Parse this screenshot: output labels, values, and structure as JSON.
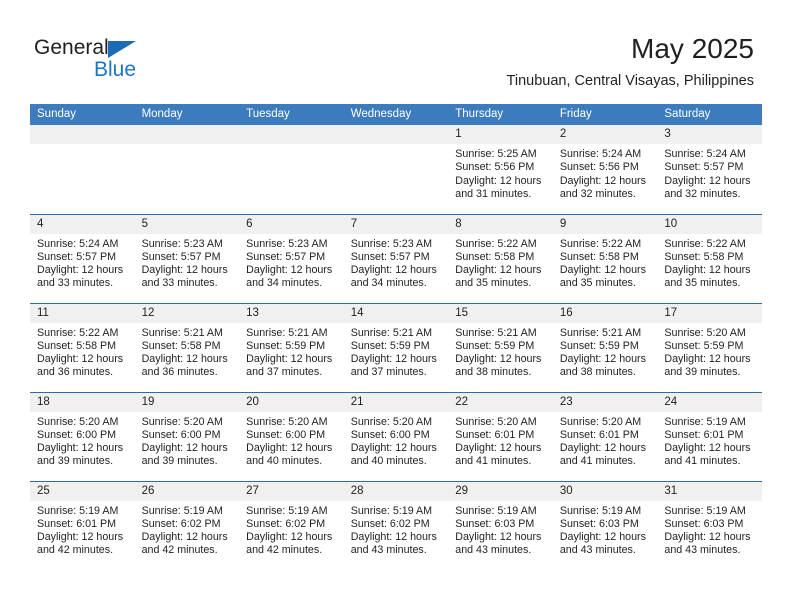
{
  "brand": {
    "line1": "General",
    "line2": "Blue",
    "triangle_color": "#1c6cb5"
  },
  "header": {
    "month_title": "May 2025",
    "location": "Tinubuan, Central Visayas, Philippines"
  },
  "theme": {
    "header_bg": "#3c7cbe",
    "header_text": "#ffffff",
    "daynum_band_bg": "#f0f0f0",
    "row_divider": "#2e6da4",
    "text": "#231f20"
  },
  "calendar": {
    "weekday_headers": [
      "Sunday",
      "Monday",
      "Tuesday",
      "Wednesday",
      "Thursday",
      "Friday",
      "Saturday"
    ],
    "weeks": [
      [
        {
          "day": "",
          "empty": true
        },
        {
          "day": "",
          "empty": true
        },
        {
          "day": "",
          "empty": true
        },
        {
          "day": "",
          "empty": true
        },
        {
          "day": "1",
          "sunrise": "Sunrise: 5:25 AM",
          "sunset": "Sunset: 5:56 PM",
          "daylight1": "Daylight: 12 hours",
          "daylight2": "and 31 minutes."
        },
        {
          "day": "2",
          "sunrise": "Sunrise: 5:24 AM",
          "sunset": "Sunset: 5:56 PM",
          "daylight1": "Daylight: 12 hours",
          "daylight2": "and 32 minutes."
        },
        {
          "day": "3",
          "sunrise": "Sunrise: 5:24 AM",
          "sunset": "Sunset: 5:57 PM",
          "daylight1": "Daylight: 12 hours",
          "daylight2": "and 32 minutes."
        }
      ],
      [
        {
          "day": "4",
          "sunrise": "Sunrise: 5:24 AM",
          "sunset": "Sunset: 5:57 PM",
          "daylight1": "Daylight: 12 hours",
          "daylight2": "and 33 minutes."
        },
        {
          "day": "5",
          "sunrise": "Sunrise: 5:23 AM",
          "sunset": "Sunset: 5:57 PM",
          "daylight1": "Daylight: 12 hours",
          "daylight2": "and 33 minutes."
        },
        {
          "day": "6",
          "sunrise": "Sunrise: 5:23 AM",
          "sunset": "Sunset: 5:57 PM",
          "daylight1": "Daylight: 12 hours",
          "daylight2": "and 34 minutes."
        },
        {
          "day": "7",
          "sunrise": "Sunrise: 5:23 AM",
          "sunset": "Sunset: 5:57 PM",
          "daylight1": "Daylight: 12 hours",
          "daylight2": "and 34 minutes."
        },
        {
          "day": "8",
          "sunrise": "Sunrise: 5:22 AM",
          "sunset": "Sunset: 5:58 PM",
          "daylight1": "Daylight: 12 hours",
          "daylight2": "and 35 minutes."
        },
        {
          "day": "9",
          "sunrise": "Sunrise: 5:22 AM",
          "sunset": "Sunset: 5:58 PM",
          "daylight1": "Daylight: 12 hours",
          "daylight2": "and 35 minutes."
        },
        {
          "day": "10",
          "sunrise": "Sunrise: 5:22 AM",
          "sunset": "Sunset: 5:58 PM",
          "daylight1": "Daylight: 12 hours",
          "daylight2": "and 35 minutes."
        }
      ],
      [
        {
          "day": "11",
          "sunrise": "Sunrise: 5:22 AM",
          "sunset": "Sunset: 5:58 PM",
          "daylight1": "Daylight: 12 hours",
          "daylight2": "and 36 minutes."
        },
        {
          "day": "12",
          "sunrise": "Sunrise: 5:21 AM",
          "sunset": "Sunset: 5:58 PM",
          "daylight1": "Daylight: 12 hours",
          "daylight2": "and 36 minutes."
        },
        {
          "day": "13",
          "sunrise": "Sunrise: 5:21 AM",
          "sunset": "Sunset: 5:59 PM",
          "daylight1": "Daylight: 12 hours",
          "daylight2": "and 37 minutes."
        },
        {
          "day": "14",
          "sunrise": "Sunrise: 5:21 AM",
          "sunset": "Sunset: 5:59 PM",
          "daylight1": "Daylight: 12 hours",
          "daylight2": "and 37 minutes."
        },
        {
          "day": "15",
          "sunrise": "Sunrise: 5:21 AM",
          "sunset": "Sunset: 5:59 PM",
          "daylight1": "Daylight: 12 hours",
          "daylight2": "and 38 minutes."
        },
        {
          "day": "16",
          "sunrise": "Sunrise: 5:21 AM",
          "sunset": "Sunset: 5:59 PM",
          "daylight1": "Daylight: 12 hours",
          "daylight2": "and 38 minutes."
        },
        {
          "day": "17",
          "sunrise": "Sunrise: 5:20 AM",
          "sunset": "Sunset: 5:59 PM",
          "daylight1": "Daylight: 12 hours",
          "daylight2": "and 39 minutes."
        }
      ],
      [
        {
          "day": "18",
          "sunrise": "Sunrise: 5:20 AM",
          "sunset": "Sunset: 6:00 PM",
          "daylight1": "Daylight: 12 hours",
          "daylight2": "and 39 minutes."
        },
        {
          "day": "19",
          "sunrise": "Sunrise: 5:20 AM",
          "sunset": "Sunset: 6:00 PM",
          "daylight1": "Daylight: 12 hours",
          "daylight2": "and 39 minutes."
        },
        {
          "day": "20",
          "sunrise": "Sunrise: 5:20 AM",
          "sunset": "Sunset: 6:00 PM",
          "daylight1": "Daylight: 12 hours",
          "daylight2": "and 40 minutes."
        },
        {
          "day": "21",
          "sunrise": "Sunrise: 5:20 AM",
          "sunset": "Sunset: 6:00 PM",
          "daylight1": "Daylight: 12 hours",
          "daylight2": "and 40 minutes."
        },
        {
          "day": "22",
          "sunrise": "Sunrise: 5:20 AM",
          "sunset": "Sunset: 6:01 PM",
          "daylight1": "Daylight: 12 hours",
          "daylight2": "and 41 minutes."
        },
        {
          "day": "23",
          "sunrise": "Sunrise: 5:20 AM",
          "sunset": "Sunset: 6:01 PM",
          "daylight1": "Daylight: 12 hours",
          "daylight2": "and 41 minutes."
        },
        {
          "day": "24",
          "sunrise": "Sunrise: 5:19 AM",
          "sunset": "Sunset: 6:01 PM",
          "daylight1": "Daylight: 12 hours",
          "daylight2": "and 41 minutes."
        }
      ],
      [
        {
          "day": "25",
          "sunrise": "Sunrise: 5:19 AM",
          "sunset": "Sunset: 6:01 PM",
          "daylight1": "Daylight: 12 hours",
          "daylight2": "and 42 minutes."
        },
        {
          "day": "26",
          "sunrise": "Sunrise: 5:19 AM",
          "sunset": "Sunset: 6:02 PM",
          "daylight1": "Daylight: 12 hours",
          "daylight2": "and 42 minutes."
        },
        {
          "day": "27",
          "sunrise": "Sunrise: 5:19 AM",
          "sunset": "Sunset: 6:02 PM",
          "daylight1": "Daylight: 12 hours",
          "daylight2": "and 42 minutes."
        },
        {
          "day": "28",
          "sunrise": "Sunrise: 5:19 AM",
          "sunset": "Sunset: 6:02 PM",
          "daylight1": "Daylight: 12 hours",
          "daylight2": "and 43 minutes."
        },
        {
          "day": "29",
          "sunrise": "Sunrise: 5:19 AM",
          "sunset": "Sunset: 6:03 PM",
          "daylight1": "Daylight: 12 hours",
          "daylight2": "and 43 minutes."
        },
        {
          "day": "30",
          "sunrise": "Sunrise: 5:19 AM",
          "sunset": "Sunset: 6:03 PM",
          "daylight1": "Daylight: 12 hours",
          "daylight2": "and 43 minutes."
        },
        {
          "day": "31",
          "sunrise": "Sunrise: 5:19 AM",
          "sunset": "Sunset: 6:03 PM",
          "daylight1": "Daylight: 12 hours",
          "daylight2": "and 43 minutes."
        }
      ]
    ]
  }
}
